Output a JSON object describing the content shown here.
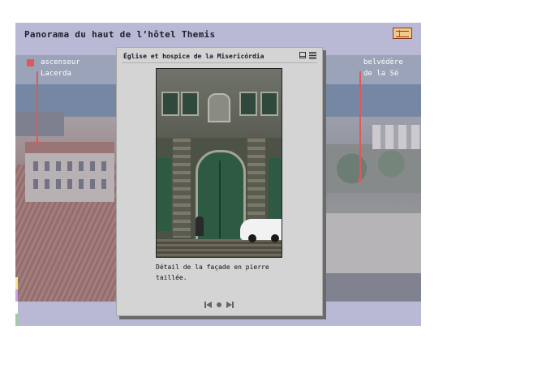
{
  "app": {
    "title": "Panorama du haut de l’hôtel Themis",
    "map_icon": "map-icon"
  },
  "hotspots": [
    {
      "line1": "ascenseur",
      "line2": "Lacerda"
    },
    {
      "line1": "belvédère",
      "line2": "de la Sé"
    }
  ],
  "popup": {
    "title": "Église et hospice de la Misericórdia",
    "icons": [
      "window-icon",
      "list-icon"
    ],
    "image": "church-facade-photo",
    "caption": "Détail de la façade en pierre taillée.",
    "nav": [
      "previous-icon",
      "dot-icon",
      "next-icon"
    ]
  },
  "colors": {
    "background": "#b9b9d6",
    "accent": "#e05858",
    "popup_bg": "#d4d4d4"
  }
}
